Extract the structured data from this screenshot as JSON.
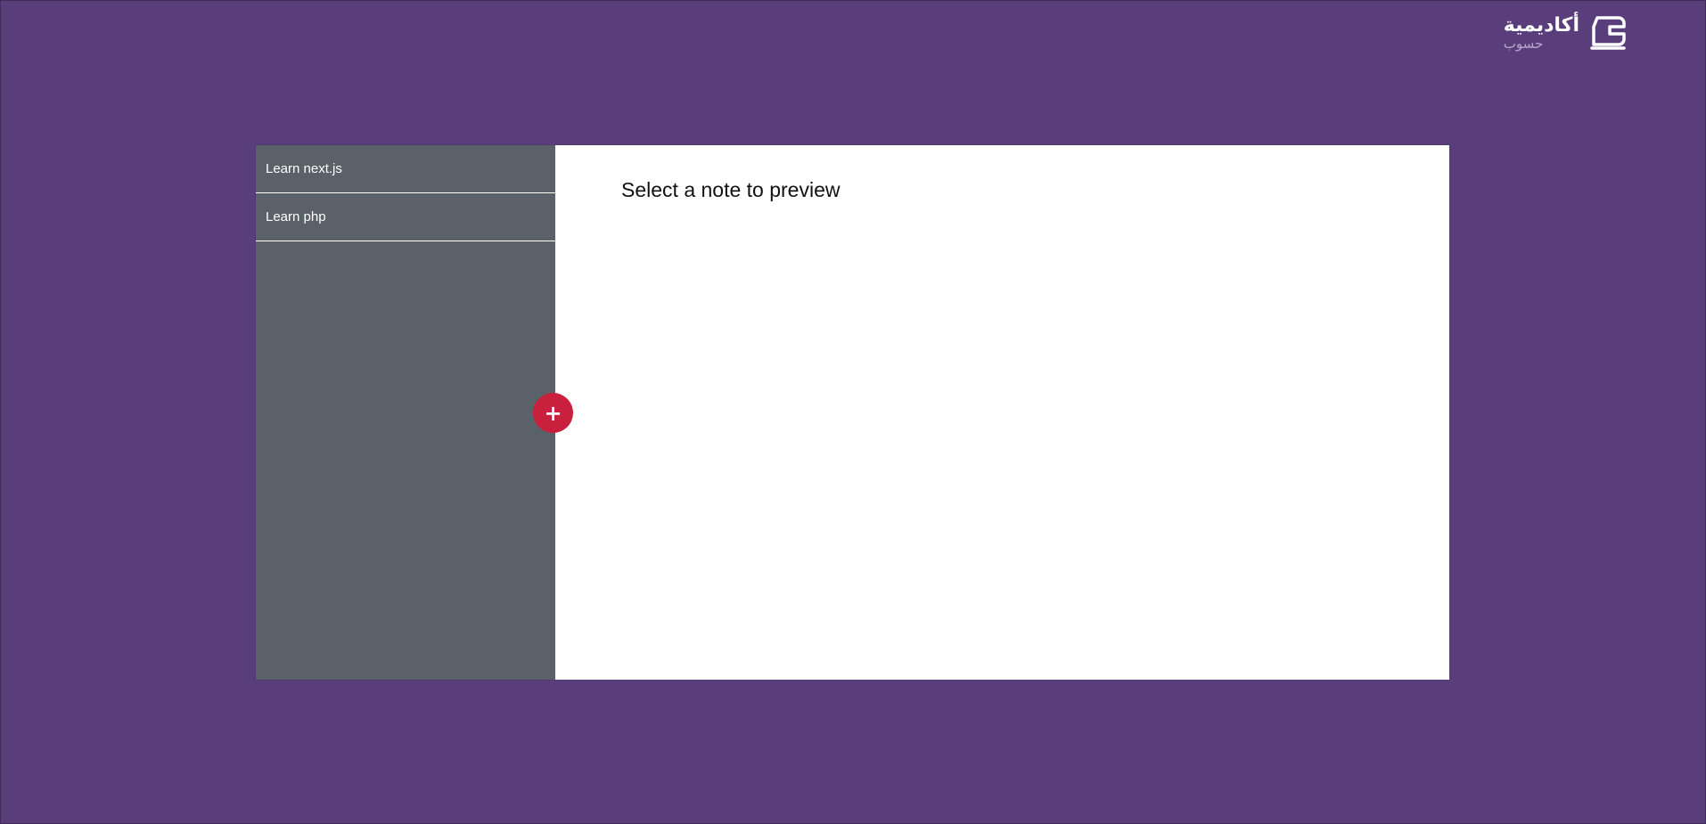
{
  "logo": {
    "title": "أكاديمية",
    "subtitle": "حسوب",
    "icon": "hsoub-academy-logo-icon"
  },
  "sidebar": {
    "notes": [
      {
        "label": "Learn next.js"
      },
      {
        "label": "Learn php"
      }
    ],
    "add_button": {
      "label": "+",
      "icon": "plus-icon",
      "color": "#c8203d"
    },
    "background": "#5b6169"
  },
  "preview": {
    "placeholder_title": "Select a note to preview"
  },
  "colors": {
    "page_background": "#5a3d7b",
    "sidebar": "#5b6169",
    "preview": "#ffffff",
    "accent": "#c8203d"
  }
}
